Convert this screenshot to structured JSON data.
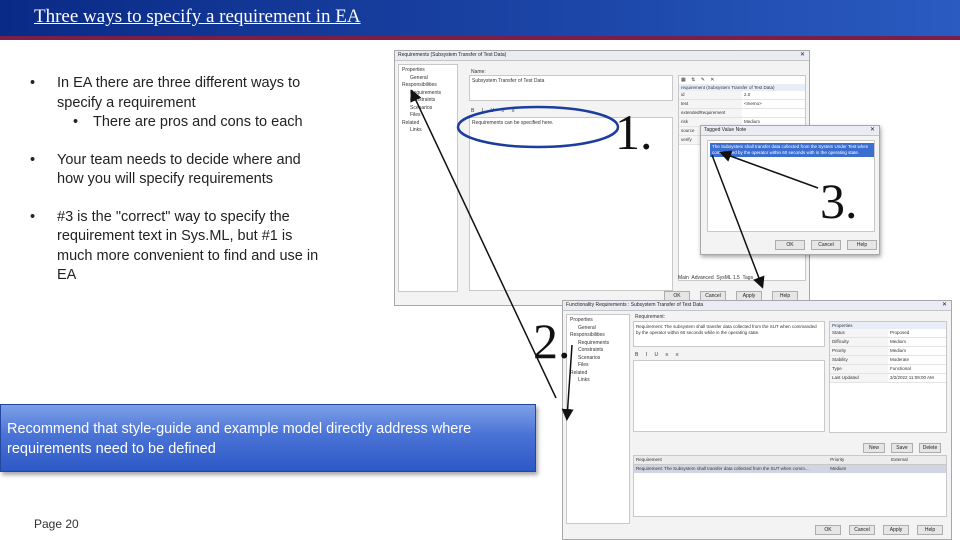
{
  "header": {
    "title": "Three ways to specify a requirement in EA"
  },
  "bullets": [
    {
      "text": "In EA there are three different ways to specify a requirement",
      "sub": [
        "There are pros and cons to each"
      ]
    },
    {
      "text": "Your team needs to decide where and how you will specify requirements"
    },
    {
      "text": "#3 is the \"correct\" way to specify the requirement text in Sys.ML, but #1 is much more convenient to find and use in EA"
    }
  ],
  "bullet_glyph": "•",
  "callout": {
    "text": "Recommend that style-guide and example model directly address where requirements need to be defined"
  },
  "footer": {
    "page": "Page 20"
  },
  "labels": {
    "one": "1.",
    "two": "2.",
    "three": "3."
  },
  "screenshot1": {
    "title": "Requirements (Subsystem Transfer of Test Data)",
    "tree": [
      "Properties",
      "General",
      "Responsibilities",
      "Requirements",
      "Constraints",
      "Scenarios",
      "Files",
      "Related",
      "Links"
    ],
    "name_label": "Name:",
    "name_value": "Subsystem Transfer of Test Data",
    "notes_text": "Requirements can be specified here.",
    "props_header": "requirement (Subsystem Transfer of Test Data)",
    "props": [
      [
        "id",
        "2.0"
      ],
      [
        "text",
        "<memo>"
      ],
      [
        "extendedRequirement",
        ""
      ],
      [
        "risk",
        "Medium"
      ],
      [
        "source",
        ""
      ],
      [
        "verify",
        ""
      ]
    ],
    "tabs": [
      "Main",
      "Advanced",
      "SysML 1.5",
      "Tags"
    ],
    "buttons": [
      "OK",
      "Cancel",
      "Apply",
      "Help"
    ]
  },
  "screenshot3": {
    "title": "Tagged Value Note",
    "text": "The Subsystem shall transfer data collected from the System Under Test when commanded by the operator within 60 seconds with in the operating state.",
    "buttons": [
      "OK",
      "Cancel",
      "Help"
    ]
  },
  "screenshot2": {
    "title": "Functionality Requirements : Subsystem Transfer of Test Data",
    "tree": [
      "Properties",
      "General",
      "Responsibilities",
      "Requirements",
      "Constraints",
      "Scenarios",
      "Files",
      "Related",
      "Links"
    ],
    "req_label": "Requirement:",
    "req_text": "Requirement: The subsystem shall transfer data collected from the SUT when commanded by the operator within 60 seconds while in the operating state.",
    "props_header": "Properties",
    "props": [
      [
        "Status",
        "Proposed"
      ],
      [
        "Difficulty",
        "Medium"
      ],
      [
        "Priority",
        "Medium"
      ],
      [
        "Stability",
        "Moderate"
      ],
      [
        "Type",
        "Functional"
      ],
      [
        "Last Updated",
        "3/2/2022 11:09:00 AM"
      ]
    ],
    "list_buttons": [
      "New",
      "Save",
      "Delete"
    ],
    "columns": [
      "Requirement",
      "Priority",
      "External"
    ],
    "row": [
      "Requirement: The Subsystem shall transfer data collected from the SUT when comm...",
      "Medium",
      ""
    ],
    "buttons": [
      "OK",
      "Cancel",
      "Apply",
      "Help"
    ]
  }
}
